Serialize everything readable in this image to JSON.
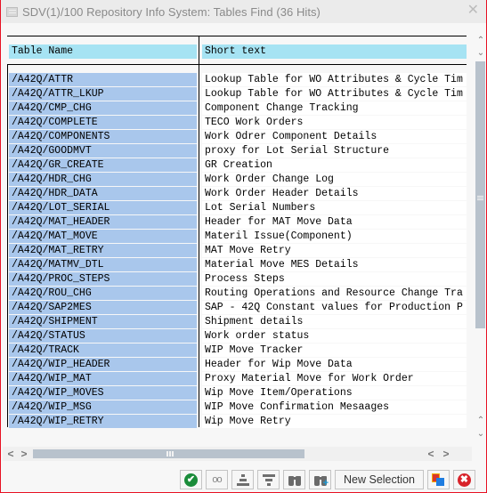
{
  "window": {
    "title": "SDV(1)/100 Repository Info System: Tables Find (36 Hits)",
    "close_glyph": "✕",
    "title_icon": "window-icon"
  },
  "grid": {
    "columns": [
      "Table Name",
      "Short text"
    ],
    "rows": [
      {
        "name": "/A42Q/ATTR",
        "text": "Lookup Table for WO Attributes & Cycle Tim"
      },
      {
        "name": "/A42Q/ATTR_LKUP",
        "text": "Lookup Table for WO Attributes & Cycle Tim"
      },
      {
        "name": "/A42Q/CMP_CHG",
        "text": "Component Change Tracking"
      },
      {
        "name": "/A42Q/COMPLETE",
        "text": "TECO Work Orders"
      },
      {
        "name": "/A42Q/COMPONENTS",
        "text": "Work Odrer Component Details"
      },
      {
        "name": "/A42Q/GOODMVT",
        "text": "proxy for Lot Serial Structure"
      },
      {
        "name": "/A42Q/GR_CREATE",
        "text": "GR Creation"
      },
      {
        "name": "/A42Q/HDR_CHG",
        "text": "Work Order Change Log"
      },
      {
        "name": "/A42Q/HDR_DATA",
        "text": "Work Order Header Details"
      },
      {
        "name": "/A42Q/LOT_SERIAL",
        "text": "Lot Serial Numbers"
      },
      {
        "name": "/A42Q/MAT_HEADER",
        "text": "Header for MAT Move Data"
      },
      {
        "name": "/A42Q/MAT_MOVE",
        "text": "Materil Issue(Component)"
      },
      {
        "name": "/A42Q/MAT_RETRY",
        "text": "MAT Move Retry"
      },
      {
        "name": "/A42Q/MATMV_DTL",
        "text": "Material Move MES Details"
      },
      {
        "name": "/A42Q/PROC_STEPS",
        "text": "Process Steps"
      },
      {
        "name": "/A42Q/ROU_CHG",
        "text": "Routing Operations and Resource Change Tra"
      },
      {
        "name": "/A42Q/SAP2MES",
        "text": "SAP - 42Q Constant values for Production P"
      },
      {
        "name": "/A42Q/SHIPMENT",
        "text": "Shipment details"
      },
      {
        "name": "/A42Q/STATUS",
        "text": "Work order status"
      },
      {
        "name": "/A42Q/TRACK",
        "text": "WIP Move Tracker"
      },
      {
        "name": "/A42Q/WIP_HEADER",
        "text": "Header for Wip Move Data"
      },
      {
        "name": "/A42Q/WIP_MAT",
        "text": "Proxy Material Move for Work Order"
      },
      {
        "name": "/A42Q/WIP_MOVES",
        "text": "Wip Move Item/Operations"
      },
      {
        "name": "/A42Q/WIP_MSG",
        "text": "WIP Move Confirmation Mesaages"
      },
      {
        "name": "/A42Q/WIP_RETRY",
        "text": "Wip Move Retry"
      }
    ]
  },
  "scrollbars": {
    "up": "⌃",
    "down": "⌄",
    "left": "<",
    "right": ">"
  },
  "toolbar": {
    "new_selection_label": "New Selection",
    "ok_glyph": "✔",
    "cancel_glyph": "✖",
    "glasses_glyph": "ꝏ"
  },
  "colors": {
    "header_bg": "#a6e3f3",
    "name_bg": "#a9c7ec",
    "window_border": "#e81123"
  }
}
